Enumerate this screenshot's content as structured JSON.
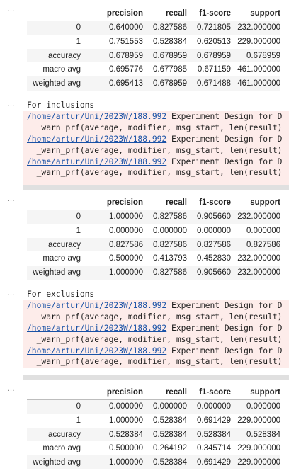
{
  "ellipsis": "…",
  "columns": [
    "",
    "precision",
    "recall",
    "f1-score",
    "support"
  ],
  "tables": [
    {
      "rows": [
        {
          "label": "0",
          "precision": "0.640000",
          "recall": "0.827586",
          "f1": "0.721805",
          "support": "232.000000"
        },
        {
          "label": "1",
          "precision": "0.751553",
          "recall": "0.528384",
          "f1": "0.620513",
          "support": "229.000000"
        },
        {
          "label": "accuracy",
          "precision": "0.678959",
          "recall": "0.678959",
          "f1": "0.678959",
          "support": "0.678959"
        },
        {
          "label": "macro avg",
          "precision": "0.695776",
          "recall": "0.677985",
          "f1": "0.671159",
          "support": "461.000000"
        },
        {
          "label": "weighted avg",
          "precision": "0.695413",
          "recall": "0.678959",
          "f1": "0.671488",
          "support": "461.000000"
        }
      ]
    },
    {
      "rows": [
        {
          "label": "0",
          "precision": "1.000000",
          "recall": "0.827586",
          "f1": "0.905660",
          "support": "232.000000"
        },
        {
          "label": "1",
          "precision": "0.000000",
          "recall": "0.000000",
          "f1": "0.000000",
          "support": "0.000000"
        },
        {
          "label": "accuracy",
          "precision": "0.827586",
          "recall": "0.827586",
          "f1": "0.827586",
          "support": "0.827586"
        },
        {
          "label": "macro avg",
          "precision": "0.500000",
          "recall": "0.413793",
          "f1": "0.452830",
          "support": "232.000000"
        },
        {
          "label": "weighted avg",
          "precision": "1.000000",
          "recall": "0.827586",
          "f1": "0.905660",
          "support": "232.000000"
        }
      ]
    },
    {
      "rows": [
        {
          "label": "0",
          "precision": "0.000000",
          "recall": "0.000000",
          "f1": "0.000000",
          "support": "0.000000"
        },
        {
          "label": "1",
          "precision": "1.000000",
          "recall": "0.528384",
          "f1": "0.691429",
          "support": "229.000000"
        },
        {
          "label": "accuracy",
          "precision": "0.528384",
          "recall": "0.528384",
          "f1": "0.528384",
          "support": "0.528384"
        },
        {
          "label": "macro avg",
          "precision": "0.500000",
          "recall": "0.264192",
          "f1": "0.345714",
          "support": "229.000000"
        },
        {
          "label": "weighted avg",
          "precision": "1.000000",
          "recall": "0.528384",
          "f1": "0.691429",
          "support": "229.000000"
        }
      ]
    }
  ],
  "streams": [
    {
      "heading": "For inclusions",
      "warnings": [
        {
          "link": "/home/artur/Uni/2023W/188.992",
          "text": " Experiment Design for D",
          "detail": "  _warn_prf(average, modifier, msg_start, len(result)"
        },
        {
          "link": "/home/artur/Uni/2023W/188.992",
          "text": " Experiment Design for D",
          "detail": "  _warn_prf(average, modifier, msg_start, len(result)"
        },
        {
          "link": "/home/artur/Uni/2023W/188.992",
          "text": " Experiment Design for D",
          "detail": "  _warn_prf(average, modifier, msg_start, len(result)"
        }
      ]
    },
    {
      "heading": "For exclusions",
      "warnings": [
        {
          "link": "/home/artur/Uni/2023W/188.992",
          "text": " Experiment Design for D",
          "detail": "  _warn_prf(average, modifier, msg_start, len(result)"
        },
        {
          "link": "/home/artur/Uni/2023W/188.992",
          "text": " Experiment Design for D",
          "detail": "  _warn_prf(average, modifier, msg_start, len(result)"
        },
        {
          "link": "/home/artur/Uni/2023W/188.992",
          "text": " Experiment Design for D",
          "detail": "  _warn_prf(average, modifier, msg_start, len(result)"
        }
      ]
    }
  ]
}
